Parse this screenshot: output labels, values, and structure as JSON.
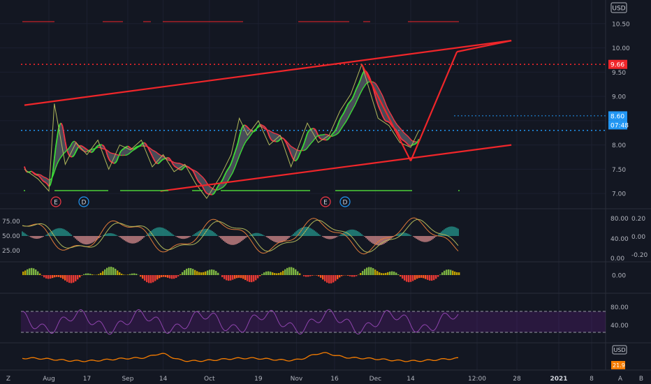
{
  "chart_data": {
    "type": "line",
    "currency_label": "USD",
    "x_tick_labels": [
      "Aug",
      "17",
      "Sep",
      "14",
      "Oct",
      "19",
      "Nov",
      "16",
      "Dec",
      "14",
      "12:00",
      "28",
      "2021",
      "8",
      "A",
      "B",
      "Z"
    ],
    "main": {
      "y_ticks": [
        "7.00",
        "7.50",
        "8.00",
        "8.50",
        "9.00",
        "9.50",
        "10.00",
        "10.50"
      ],
      "ylim": [
        6.7,
        10.9
      ],
      "highlight_labels": [
        {
          "text": "9.66",
          "color": "#f0262a"
        },
        {
          "text": "8.60",
          "color": "#2196f3"
        },
        {
          "text": "07:48",
          "color": "#2196f3"
        }
      ],
      "resistance_level": 9.66,
      "support_level": 8.3,
      "last_price": 8.6,
      "price_series": [
        [
          "Jul 25",
          7.5
        ],
        [
          "Jul 30",
          7.3
        ],
        [
          "Aug 3",
          7.05
        ],
        [
          "Aug 5",
          8.85
        ],
        [
          "Aug 9",
          7.6
        ],
        [
          "Aug 13",
          8.05
        ],
        [
          "Aug 17",
          7.8
        ],
        [
          "Aug 21",
          8.1
        ],
        [
          "Aug 25",
          7.5
        ],
        [
          "Aug 29",
          8.0
        ],
        [
          "Sep 2",
          7.9
        ],
        [
          "Sep 6",
          8.1
        ],
        [
          "Sep 10",
          7.55
        ],
        [
          "Sep 14",
          7.8
        ],
        [
          "Sep 18",
          7.45
        ],
        [
          "Sep 22",
          7.6
        ],
        [
          "Sep 26",
          7.2
        ],
        [
          "Sep 30",
          6.9
        ],
        [
          "Oct 5",
          7.35
        ],
        [
          "Oct 9",
          7.8
        ],
        [
          "Oct 12",
          8.55
        ],
        [
          "Oct 15",
          8.2
        ],
        [
          "Oct 19",
          8.5
        ],
        [
          "Oct 23",
          8.0
        ],
        [
          "Oct 27",
          8.2
        ],
        [
          "Oct 31",
          7.55
        ],
        [
          "Nov 3",
          8.0
        ],
        [
          "Nov 6",
          8.45
        ],
        [
          "Nov 10",
          8.05
        ],
        [
          "Nov 14",
          8.2
        ],
        [
          "Nov 18",
          8.7
        ],
        [
          "Nov 22",
          9.05
        ],
        [
          "Nov 26",
          9.66
        ],
        [
          "Nov 29",
          9.1
        ],
        [
          "Dec 2",
          8.55
        ],
        [
          "Dec 6",
          8.4
        ],
        [
          "Dec 10",
          8.05
        ],
        [
          "Dec 14",
          7.95
        ],
        [
          "Dec 17",
          8.3
        ]
      ],
      "trendlines": [
        {
          "from": [
            "Jul 25",
            8.82
          ],
          "to": [
            "Jan 20",
            10.15
          ]
        },
        {
          "from": [
            "Sep 13",
            7.05
          ],
          "to": [
            "Jan 20",
            8.0
          ]
        },
        {
          "from": [
            "Nov 26",
            9.66
          ],
          "to": [
            "Dec 14",
            7.67
          ]
        },
        {
          "from": [
            "Dec 14",
            7.67
          ],
          "to": [
            "Dec 31",
            9.92
          ]
        },
        {
          "from": [
            "Dec 31",
            9.92
          ],
          "to": [
            "Jan 20",
            10.15
          ]
        }
      ],
      "event_markers": [
        "E",
        "D",
        "E",
        "D"
      ]
    },
    "oscillator": {
      "left_ticks": [
        "75.00",
        "50.00",
        "25.00"
      ],
      "mid_ticks": [
        "80.00",
        "40.00",
        "0.00"
      ],
      "right_ticks": [
        "0.20",
        "0.00",
        "-0.20"
      ]
    },
    "histogram": {
      "ticks": [
        "0.00"
      ]
    },
    "rsi": {
      "ticks": [
        "80.00",
        "40.00"
      ]
    },
    "volatility": {
      "ticks": [
        "21.9"
      ],
      "currency_label": "USD",
      "last_value": 21.9
    }
  }
}
